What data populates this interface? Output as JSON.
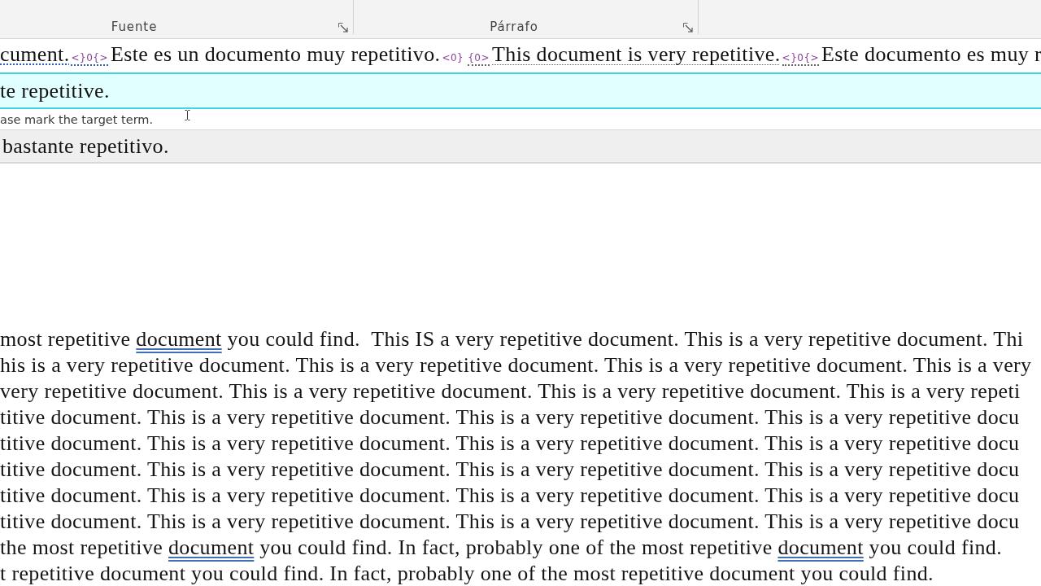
{
  "ribbon": {
    "groups": [
      {
        "label": "Fuente"
      },
      {
        "label": "Párrafo"
      }
    ]
  },
  "segment_line": {
    "parts": [
      {
        "kind": "text",
        "text": "cument.",
        "hidden": true,
        "flagged": true
      },
      {
        "kind": "tag",
        "text": "<}0{>",
        "hidden": true,
        "flagged": true
      },
      {
        "kind": "text",
        "text": "Este es un documento muy repetitivo.",
        "hidden": false,
        "flagged": false
      },
      {
        "kind": "tag",
        "text": "<0}",
        "hidden": false,
        "flagged": false
      },
      {
        "kind": "tag",
        "text": "{0>",
        "hidden": true,
        "flagged": false
      },
      {
        "kind": "text",
        "text": "This document is very repetitive.",
        "hidden": true,
        "flagged": false
      },
      {
        "kind": "tag",
        "text": "<}0{>",
        "hidden": true,
        "flagged": false
      },
      {
        "kind": "text",
        "text": "Este documento es muy r",
        "hidden": false,
        "flagged": false
      }
    ]
  },
  "target_field": {
    "value": "te repetitive."
  },
  "hint": {
    "text": "ase mark the target term."
  },
  "suggestion": {
    "text": "bastante repetitivo."
  },
  "document": {
    "lines": [
      {
        "parts": [
          {
            "text": "most repetitive ",
            "flagged": false
          },
          {
            "text": "document",
            "flagged": true
          },
          {
            "text": " you could find.  This IS a very repetitive document. This is a very repetitive document. Thi",
            "flagged": false
          }
        ]
      },
      {
        "parts": [
          {
            "text": "his is a very repetitive document. This is a very repetitive document. This is a very repetitive document. This is a very",
            "flagged": false
          }
        ]
      },
      {
        "parts": [
          {
            "text": "very repetitive document. This is a very repetitive document. This is a very repetitive document. This is a very repeti",
            "flagged": false
          }
        ]
      },
      {
        "parts": [
          {
            "text": "titive document. This is a very repetitive document. This is a very repetitive document. This is a very repetitive docu",
            "flagged": false
          }
        ]
      },
      {
        "parts": [
          {
            "text": "titive document. This is a very repetitive document. This is a very repetitive document. This is a very repetitive docu",
            "flagged": false
          }
        ]
      },
      {
        "parts": [
          {
            "text": "titive document. This is a very repetitive document. This is a very repetitive document. This is a very repetitive docu",
            "flagged": false
          }
        ]
      },
      {
        "parts": [
          {
            "text": "titive document. This is a very repetitive document. This is a very repetitive document. This is a very repetitive docu",
            "flagged": false
          }
        ]
      },
      {
        "parts": [
          {
            "text": "titive document. This is a very repetitive document. This is a very repetitive document. This is a very repetitive docu",
            "flagged": false
          }
        ]
      },
      {
        "parts": [
          {
            "text": "the most repetitive ",
            "flagged": false
          },
          {
            "text": "document",
            "flagged": true
          },
          {
            "text": " you could find. In fact, probably one of the most repetitive ",
            "flagged": false
          },
          {
            "text": "document",
            "flagged": true
          },
          {
            "text": " you could find.",
            "flagged": false
          }
        ]
      },
      {
        "parts": [
          {
            "text": "t repetitive document you could find. In fact, probably one of the most repetitive document you could find.",
            "flagged": false
          }
        ]
      }
    ]
  }
}
